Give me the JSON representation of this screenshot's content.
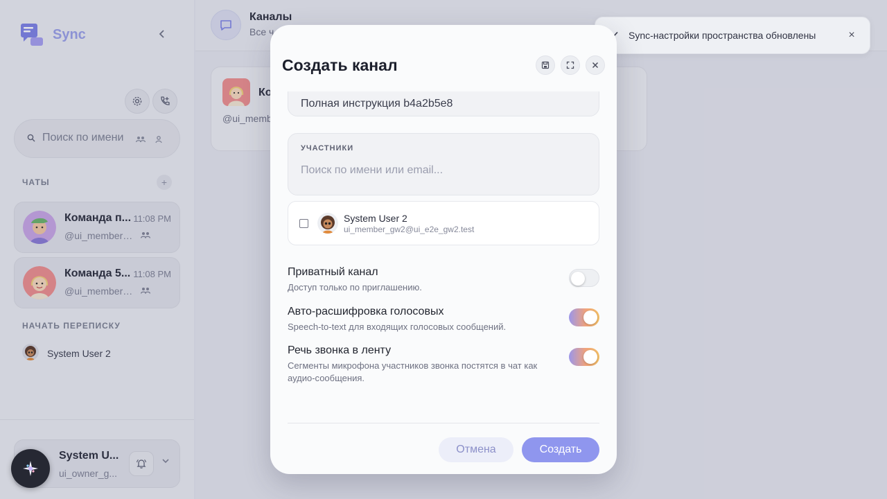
{
  "app": {
    "brand": "Sync"
  },
  "sidebar": {
    "search_placeholder": "Поиск по имени",
    "chats_label": "ЧАТЫ",
    "add_chat_glyph": "+",
    "chats": [
      {
        "name": "Команда п...",
        "time": "11:08 PM",
        "handle": "@ui_member_..."
      },
      {
        "name": "Команда 5...",
        "time": "11:08 PM",
        "handle": "@ui_member_..."
      }
    ],
    "start_label": "НАЧАТЬ ПЕРЕПИСКУ",
    "dm_user": "System User 2",
    "profile": {
      "name": "System U...",
      "handle": "ui_owner_g..."
    }
  },
  "main": {
    "header": {
      "title": "Каналы",
      "subtitle": "Все ч"
    },
    "card": {
      "title": "Ко",
      "handle": "@ui_memb"
    }
  },
  "toast": {
    "text": "Sync-настройки пространства обновлены",
    "close_glyph": "×"
  },
  "modal": {
    "title": "Создать канал",
    "description_value": "Полная инструкция b4a2b5e8",
    "members": {
      "label": "УЧАСТНИКИ",
      "placeholder": "Поиск по имени или email..."
    },
    "user": {
      "name": "System User 2",
      "email": "ui_member_gw2@ui_e2e_gw2.test",
      "checked": false
    },
    "options": [
      {
        "title": "Приватный канал",
        "desc": "Доступ только по приглашению.",
        "on": false
      },
      {
        "title": "Авто-расшифровка голосовых",
        "desc": "Speech-to-text для входящих голосовых сообщений.",
        "on": true
      },
      {
        "title": "Речь звонка в ленту",
        "desc": "Сегменты микрофона участников звонка постятся в чат как аудио-сообщения.",
        "on": true
      }
    ],
    "cancel_label": "Отмена",
    "create_label": "Создать"
  },
  "colors": {
    "accent": "#8f96ee",
    "toggle_gradient_start": "#9b96ea",
    "toggle_gradient_end": "#f6c267"
  },
  "icons": [
    "chat-bubble-icon",
    "chevron-left-icon",
    "gear-icon",
    "phone-add-icon",
    "search-icon",
    "group-icon",
    "user-icon",
    "bell-icon",
    "chevron-down-icon",
    "save-icon",
    "expand-icon",
    "close-icon",
    "check-icon",
    "sparkle-icon"
  ]
}
